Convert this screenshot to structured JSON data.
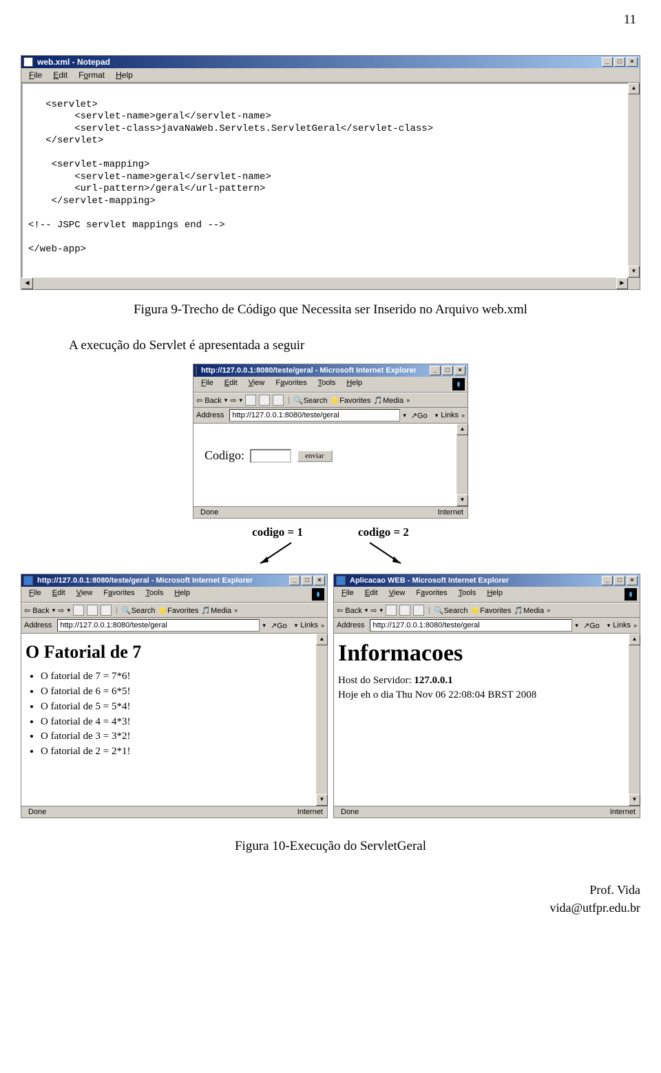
{
  "page_number": "11",
  "notepad": {
    "title": "web.xml - Notepad",
    "menu": [
      "File",
      "Edit",
      "Format",
      "Help"
    ],
    "content": "\n   <servlet>\n        <servlet-name>geral</servlet-name>\n        <servlet-class>javaNaWeb.Servlets.ServletGeral</servlet-class>\n   </servlet>\n\n    <servlet-mapping>\n        <servlet-name>geral</servlet-name>\n        <url-pattern>/geral</url-pattern>\n    </servlet-mapping>\n\n<!-- JSPC servlet mappings end -->\n\n</web-app>"
  },
  "caption1": "Figura 9-Trecho de Código que Necessita ser Inserido no Arquivo web.xml",
  "body_text1": "A execução do Servlet é apresentada a seguir",
  "ie_top": {
    "title": "http://127.0.0.1:8080/teste/geral - Microsoft Internet Explorer",
    "menu": [
      "File",
      "Edit",
      "View",
      "Favorites",
      "Tools",
      "Help"
    ],
    "toolbar": {
      "back": "Back",
      "search": "Search",
      "favorites": "Favorites",
      "media": "Media"
    },
    "address_label": "Address",
    "address_value": "http://127.0.0.1:8080/teste/geral",
    "go": "Go",
    "links": "Links",
    "form_label": "Codigo:",
    "form_button": "enviar",
    "status_left": "Done",
    "status_right": "Internet"
  },
  "arrows": {
    "left": "codigo = 1",
    "right": "codigo = 2"
  },
  "ie_left": {
    "title": "http://127.0.0.1:8080/teste/geral - Microsoft Internet Explorer",
    "menu": [
      "File",
      "Edit",
      "View",
      "Favorites",
      "Tools",
      "Help"
    ],
    "toolbar": {
      "back": "Back",
      "search": "Search",
      "favorites": "Favorites",
      "media": "Media"
    },
    "address_label": "Address",
    "address_value": "http://127.0.0.1:8080/teste/geral",
    "go": "Go",
    "links": "Links",
    "heading": "O Fatorial de 7",
    "items": [
      "O fatorial de 7 = 7*6!",
      "O fatorial de 6 = 6*5!",
      "O fatorial de 5 = 5*4!",
      "O fatorial de 4 = 4*3!",
      "O fatorial de 3 = 3*2!",
      "O fatorial de 2 = 2*1!"
    ],
    "status_left": "Done",
    "status_right": "Internet"
  },
  "ie_right": {
    "title": "Aplicacao WEB - Microsoft Internet Explorer",
    "menu": [
      "File",
      "Edit",
      "View",
      "Favorites",
      "Tools",
      "Help"
    ],
    "toolbar": {
      "back": "Back",
      "search": "Search",
      "favorites": "Favorites",
      "media": "Media"
    },
    "address_label": "Address",
    "address_value": "http://127.0.0.1:8080/teste/geral",
    "go": "Go",
    "links": "Links",
    "heading": "Informacoes",
    "line1_label": "Host do Servidor: ",
    "line1_value": "127.0.0.1",
    "line2": "Hoje eh o dia Thu Nov 06 22:08:04 BRST 2008",
    "status_left": "Done",
    "status_right": "Internet"
  },
  "caption2": "Figura 10-Execução do ServletGeral",
  "footer": {
    "l1": "Prof. Vida",
    "l2": "vida@utfpr.edu.br"
  }
}
